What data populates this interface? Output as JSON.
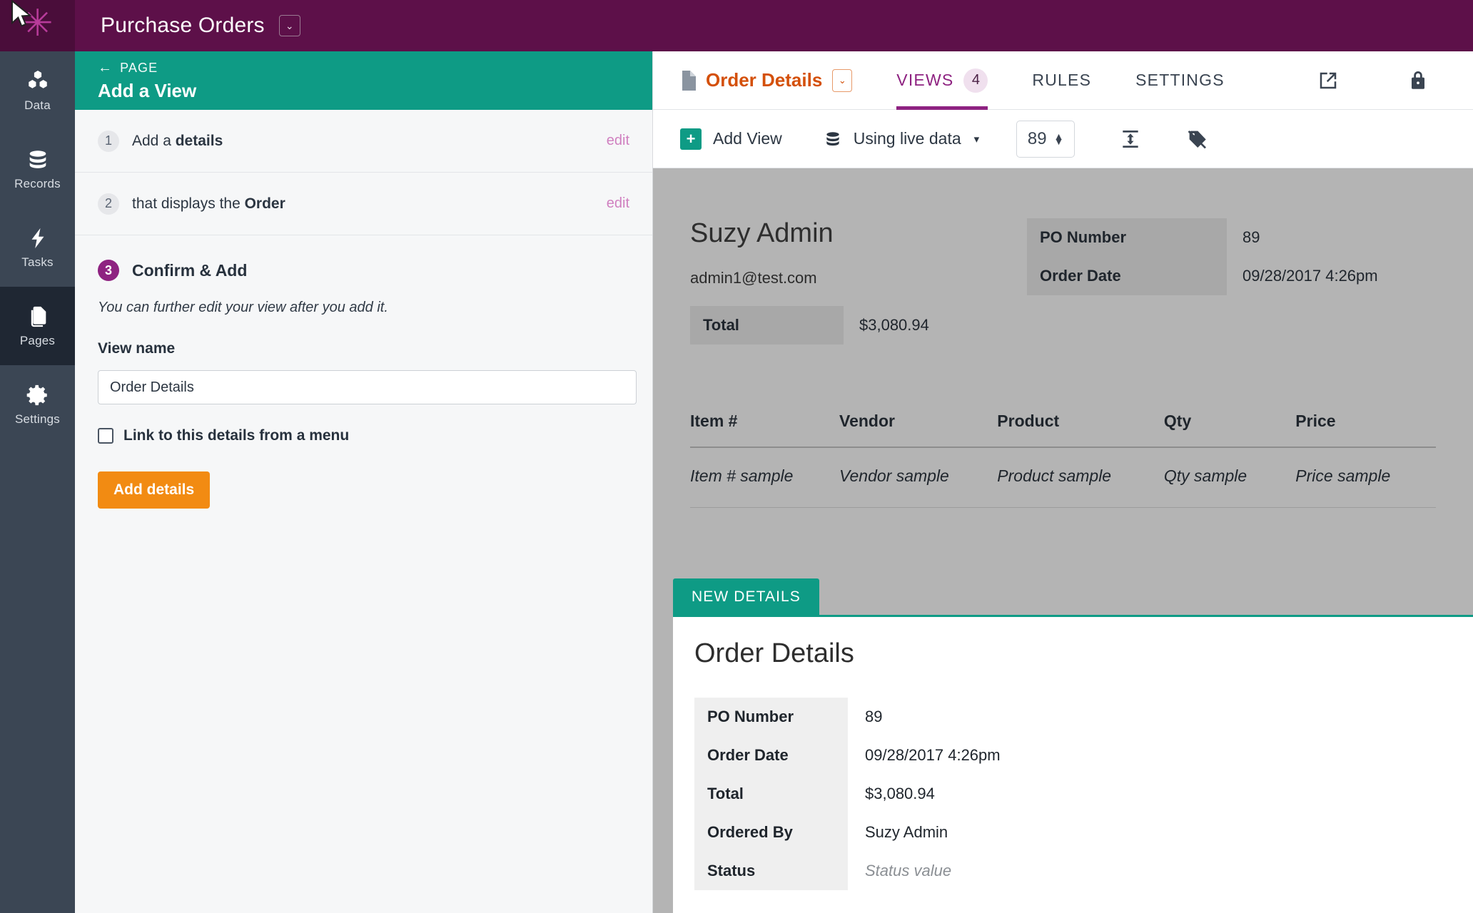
{
  "topbar": {
    "app_title": "Purchase Orders",
    "caret_glyph": "⌄",
    "logo_glyph": "✳",
    "logo_color": "#b83b9a",
    "bar_color": "#5d1049"
  },
  "rail": {
    "items": [
      {
        "label": "Data",
        "icon": "cubes-icon",
        "active": false
      },
      {
        "label": "Records",
        "icon": "database-icon",
        "active": false
      },
      {
        "label": "Tasks",
        "icon": "bolt-icon",
        "active": false
      },
      {
        "label": "Pages",
        "icon": "pages-icon",
        "active": true
      },
      {
        "label": "Settings",
        "icon": "gear-icon",
        "active": false
      }
    ]
  },
  "wizard": {
    "back_label": "PAGE",
    "back_arrow": "←",
    "title": "Add a View",
    "header_color": "#0e9b85",
    "steps": [
      {
        "num": "1",
        "text_prefix": "Add a ",
        "text_bold": "details",
        "edit_label": "edit"
      },
      {
        "num": "2",
        "text_prefix": "that displays the ",
        "text_bold": "Order",
        "edit_label": "edit"
      }
    ],
    "step3": {
      "num": "3",
      "title": "Confirm & Add",
      "hint": "You can further edit your view after you add it.",
      "field_label": "View name",
      "view_name_value": "Order Details",
      "view_name_placeholder": "View name",
      "checkbox_label": "Link to this details from a menu",
      "checkbox_checked": false,
      "submit_label": "Add details",
      "submit_color": "#f28b12"
    }
  },
  "right": {
    "doc_name": "Order Details",
    "doc_caret": "⌄",
    "tabs": [
      {
        "label": "VIEWS",
        "badge": "4",
        "active": true
      },
      {
        "label": "RULES",
        "badge": "",
        "active": false
      },
      {
        "label": "SETTINGS",
        "badge": "",
        "active": false
      }
    ],
    "tabbar_icons": [
      {
        "name": "external-link-icon"
      },
      {
        "name": "lock-icon"
      }
    ],
    "toolbar": {
      "add_view_label": "Add View",
      "data_source_label": "Using live data",
      "data_source_caret": "▾",
      "record_number": "89",
      "icons": [
        {
          "name": "row-height-icon"
        },
        {
          "name": "hide-labels-icon"
        }
      ]
    }
  },
  "preview": {
    "person_name": "Suzy Admin",
    "person_email": "admin1@test.com",
    "left_rows": [
      {
        "label": "Total",
        "value": "$3,080.94"
      }
    ],
    "right_rows": [
      {
        "label": "PO Number",
        "value": "89"
      },
      {
        "label": "Order Date",
        "value": "09/28/2017 4:26pm"
      }
    ],
    "table": {
      "headers": [
        "Item #",
        "Vendor",
        "Product",
        "Qty",
        "Price"
      ],
      "rows": [
        [
          "Item # sample",
          "Vendor sample",
          "Product sample",
          "Qty sample",
          "Price sample"
        ]
      ]
    }
  },
  "card": {
    "tab_label": "NEW DETAILS",
    "tab_color": "#0e9b85",
    "title": "Order Details",
    "rows": [
      {
        "label": "PO Number",
        "value": "89",
        "muted": false
      },
      {
        "label": "Order Date",
        "value": "09/28/2017 4:26pm",
        "muted": false
      },
      {
        "label": "Total",
        "value": "$3,080.94",
        "muted": false
      },
      {
        "label": "Ordered By",
        "value": "Suzy Admin",
        "muted": false
      },
      {
        "label": "Status",
        "value": "Status value",
        "muted": true
      }
    ]
  }
}
